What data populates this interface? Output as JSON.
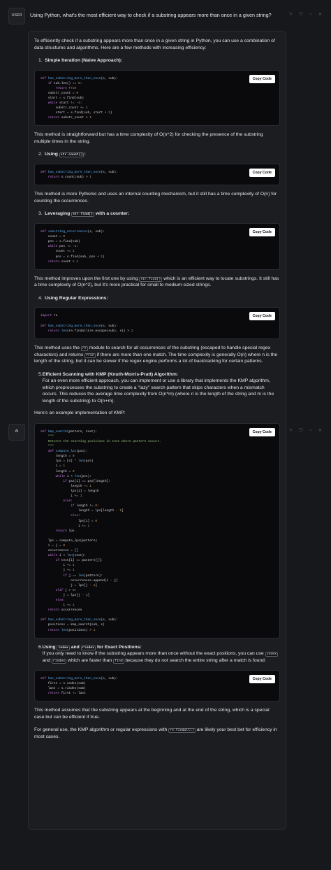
{
  "user": {
    "avatar_label": "USER",
    "message": "Using Python, what's the most efficient way to check if a substring appears more than once in a given string?"
  },
  "ai": {
    "avatar_label": "AI"
  },
  "copy_label": "Copy Code",
  "answer": {
    "intro": "To efficiently check if a substring appears more than once in a given string in Python, you can use a combination of data structures and algorithms. Here are a few methods with increasing efficiency:",
    "m1_title": "Simple Iteration (Naive Approach):",
    "m1_after": "This method is straightforward but has a time complexity of O(n^2) for checking the presence of the substring multiple times in the string.",
    "m2_title_pre": "Using",
    "m2_code": "str.count()",
    "m2_after": "This method is more Pythonic and uses an internal counting mechanism, but it still has a time complexity of O(n) for counting the occurrences.",
    "m3_title_pre": "Leveraging",
    "m3_code": "str.find()",
    "m3_title_post": "with a counter:",
    "m3_after_1": "This method improves upon the first one by using",
    "m3_after_code": "str.find()",
    "m3_after_2": "which is an efficient way to locate substrings. It still has a time complexity of O(n^2), but it's more practical for small to medium-sized strings.",
    "m4_title": "Using Regular Expressions:",
    "m4_after_1": "This method uses the",
    "m4_after_code1": "re",
    "m4_after_2": "module to search for all occurrences of the substring (escaped to handle special regex characters) and returns",
    "m4_after_code2": "True",
    "m4_after_3": "if there are more than one match. The time complexity is generally O(n) where n is the length of the string, but it can be slower if the regex engine performs a lot of backtracking for certain patterns.",
    "m5_title": "Efficient Scanning with KMP (Knuth-Morris-Pratt) Algorithm:",
    "m5_text": "For an even more efficient approach, you can implement or use a library that implements the KMP algorithm, which preprocesses the substring to create a \"lazy\" search pattern that skips characters when a mismatch occurs. This reduces the average time complexity from O(n*m) (where n is the length of the string and m is the length of the substring) to O(n+m).",
    "kmp_intro": "Here's an example implementation of KMP:",
    "m6_title_pre": "Using",
    "m6_code1": "index",
    "m6_and": "and",
    "m6_code2": "rindex",
    "m6_title_post": "for Exact Positions:",
    "m6_text_1": "If you only need to know if the substring appears more than once without the exact positions, you can use",
    "m6_text_code1": "index",
    "m6_text_and": "and",
    "m6_text_code2": "rindex",
    "m6_text_2": "which are faster than",
    "m6_text_code3": "find",
    "m6_text_3": "because they do not search the entire string after a match is found:",
    "m6_after": "This method assumes that the substring appears at the beginning and at the end of the string, which is a special case but can be efficient if true.",
    "outro_1": "For general use, the KMP algorithm or regular expressions with",
    "outro_code": "re.findall()",
    "outro_2": "are likely your best bet for efficiency in most cases."
  }
}
